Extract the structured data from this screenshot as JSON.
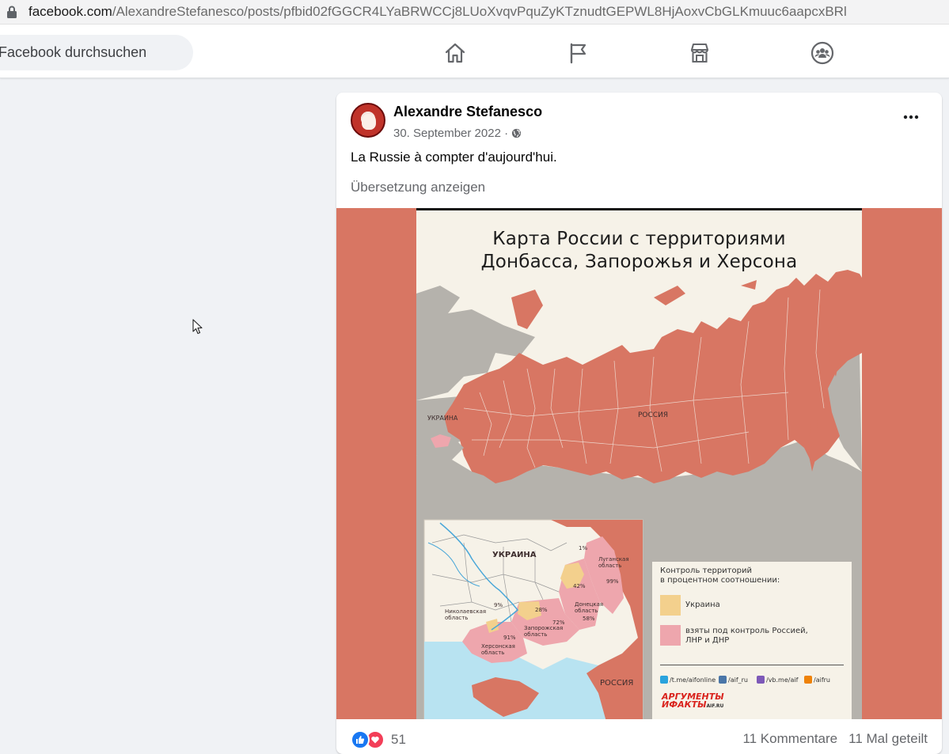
{
  "browser": {
    "url_host": "facebook.com",
    "url_path": "/AlexandreStefanesco/posts/pfbid02fGGCR4LYaBRWCCj8LUoXvqvPquZyKTznudtGEPWL8HjAoxvCbGLKmuuc6aapcxBRl"
  },
  "nav": {
    "search_placeholder": "Facebook durchsuchen",
    "icons": [
      "home-icon",
      "pages-flag-icon",
      "marketplace-icon",
      "groups-icon"
    ]
  },
  "post": {
    "author": "Alexandre Stefanesco",
    "date": "30. September 2022 ·",
    "text": "La Russie à compter d'aujourd'hui.",
    "translate_link": "Übersetzung anzeigen",
    "reaction_count": "51",
    "comments": "11 Kommentare",
    "shares": "11 Mal geteilt"
  },
  "map_image": {
    "title_line1": "Карта России с территориями",
    "title_line2": "Донбасса, Запорожья и Херсона",
    "labels": {
      "ukraine_main": "УКРАИНА",
      "russia_main": "РОССИЯ",
      "ukraine_inset": "УКРАИНА",
      "russia_inset": "РОССИЯ",
      "lugansk": "Луганская\nобласть",
      "donetsk": "Донецкая\nобласть",
      "zaporozhye": "Запорожская\nобласть",
      "kherson": "Херсонская\nобласть",
      "nikolaev": "Николаевская\nобласть"
    },
    "percentages": {
      "p1": "1%",
      "p99": "99%",
      "p42": "42%",
      "p58": "58%",
      "p28": "28%",
      "p72": "72%",
      "p9": "9%",
      "p91": "91%"
    },
    "legend": {
      "title": "Контроль территорий\nв процентном соотношении:",
      "ukraine": "Украина",
      "russia": "взяты под контроль Россией,\nЛНР и ДНР",
      "social": [
        "/t.me/aifonline",
        "/aif_ru",
        "/vb.me/aif",
        "/aifru"
      ],
      "brand": "АРГУМЕНТЫ\nИФАКТЫ",
      "brand_small": "AIF.RU"
    },
    "colors": {
      "russia": "#d87663",
      "pink": "#eea6ad",
      "yellow": "#f3d08d",
      "sea": "#b8e3f1",
      "land": "#f6f2e8"
    }
  }
}
